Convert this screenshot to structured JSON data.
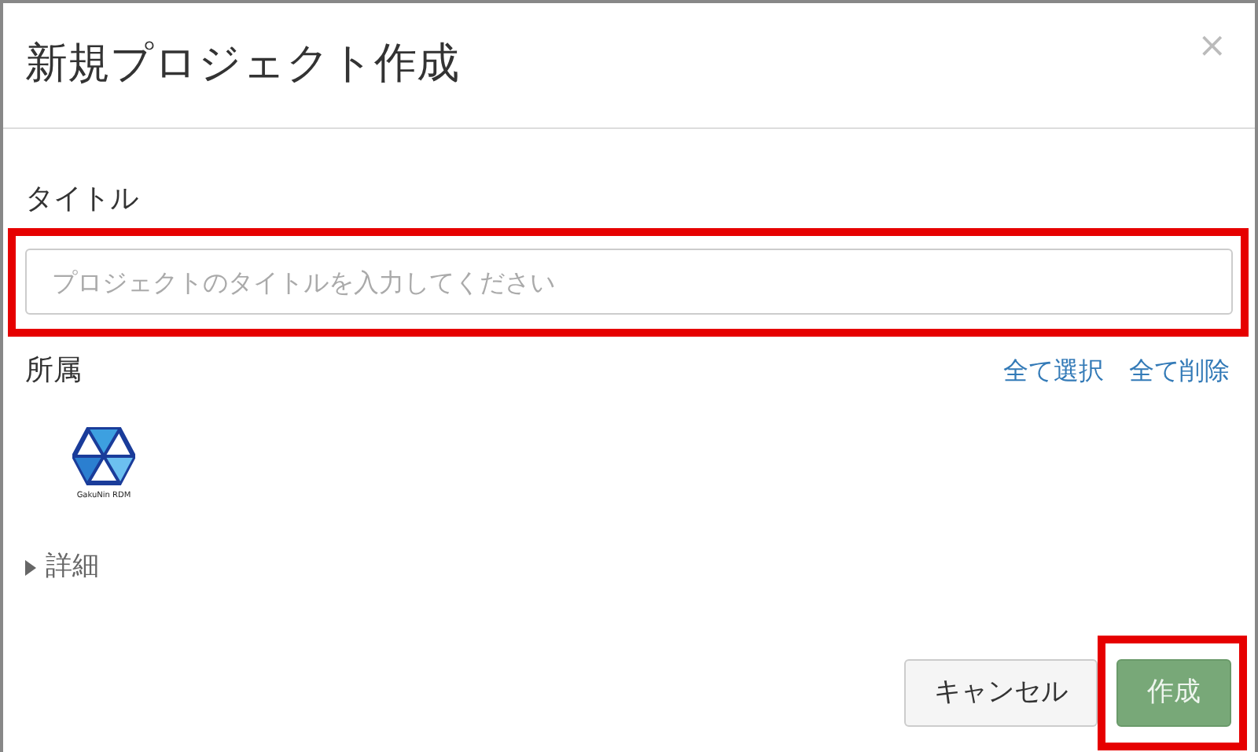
{
  "dialog": {
    "title": "新規プロジェクト作成",
    "close": "×"
  },
  "title_field": {
    "label": "タイトル",
    "placeholder": "プロジェクトのタイトルを入力してください",
    "highlighted": true
  },
  "affiliation": {
    "label": "所属",
    "links": [
      "全て選択",
      "全て削除"
    ],
    "institutions": [
      {
        "logo_text": "GakuNin RDM"
      }
    ]
  },
  "details": {
    "label": "詳細",
    "expanded": false
  },
  "buttons": [
    {
      "label": "キャンセル",
      "kind": "default",
      "highlighted": false
    },
    {
      "label": "作成",
      "kind": "primary",
      "highlighted": true
    }
  ]
}
